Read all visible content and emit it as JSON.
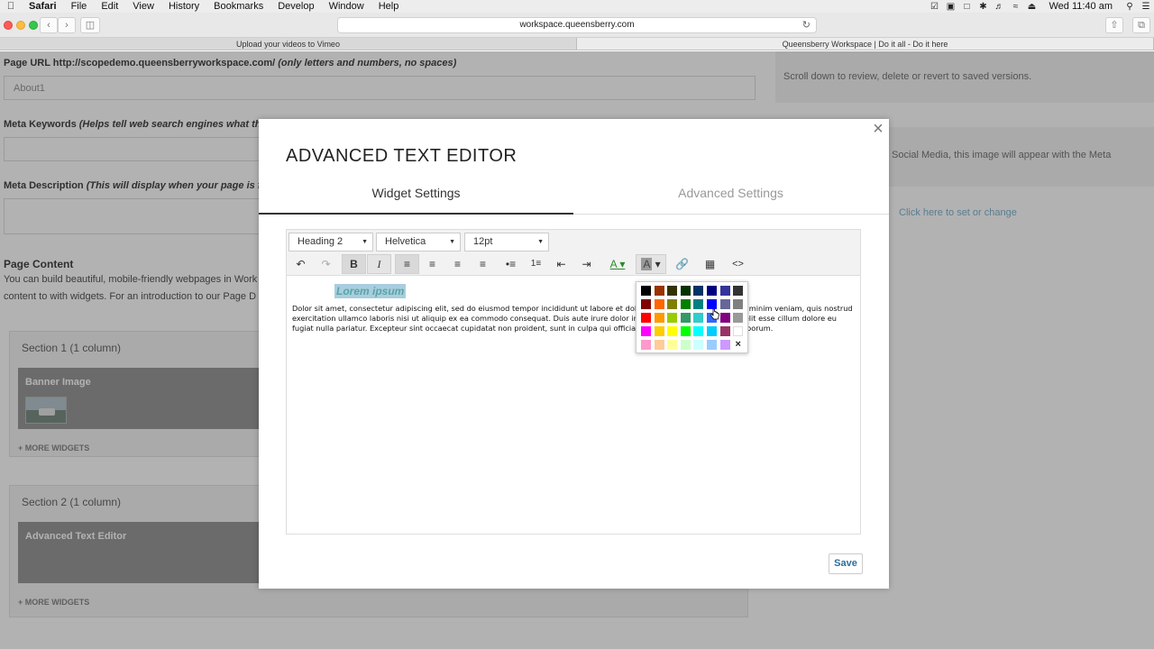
{
  "menubar": {
    "app": "Safari",
    "items": [
      "File",
      "Edit",
      "View",
      "History",
      "Bookmarks",
      "Develop",
      "Window",
      "Help"
    ],
    "clock": "Wed 11:40 am"
  },
  "browser": {
    "url": "workspace.queensberry.com",
    "tabs": [
      {
        "label": "Upload your videos to Vimeo"
      },
      {
        "label": "Queensberry Workspace | Do it all - Do it here"
      }
    ]
  },
  "page": {
    "page_url_label": "Page URL http://scopedemo.queensberryworkspace.com/",
    "page_url_hint": "(only letters and numbers, no spaces)",
    "page_url_value": "About1",
    "meta_keywords_label": "Meta Keywords",
    "meta_keywords_hint": "(Helps tell web search engines what this pa",
    "meta_description_label": "Meta Description",
    "meta_description_hint": "(This will display when your page is found",
    "page_content_heading": "Page Content",
    "page_content_line1": "You can build beautiful, mobile-friendly webpages in Work",
    "page_content_line2": "content to with widgets. For an introduction to our Page D",
    "sections": [
      {
        "title": "Section 1 (1 column)",
        "widget": "Banner Image",
        "more": "+ MORE WIDGETS"
      },
      {
        "title": "Section 2 (1 column)",
        "widget": "Advanced Text Editor",
        "more": "+ MORE WIDGETS"
      }
    ],
    "right_text1": "Scroll down to review, delete or revert to saved versions.",
    "right_text2": "Social Media, this image will appear with the Meta",
    "right_link": "Click here to set or change"
  },
  "modal": {
    "title": "ADVANCED TEXT EDITOR",
    "close_label": "×",
    "tabs": [
      "Widget Settings",
      "Advanced Settings"
    ],
    "active_tab": "Widget Settings",
    "save_label": "Save",
    "editor": {
      "block_format": "Heading 2",
      "font": "Helvetica",
      "size": "12pt",
      "heading_text": "Lorem ipsum",
      "paragraph_text": "Dolor sit amet, consectetur adipiscing elit, sed do eiusmod tempor incididunt ut labore et dolore magna aliqua. Ut enim ad minim veniam, quis nostrud exercitation ullamco laboris nisi ut aliquip ex ea commodo consequat. Duis aute irure dolor in reprehenderit in voluptate velit esse cillum dolore eu fugiat nulla pariatur. Excepteur sint occaecat cupidatat non proident, sunt in culpa qui officia deserunt mollit anim id est laborum.",
      "heading_color": "#58a6a0",
      "highlight_color": "#a9cde0"
    },
    "color_picker": {
      "swatches": [
        "#000000",
        "#993300",
        "#333300",
        "#003300",
        "#003366",
        "#000080",
        "#333399",
        "#333333",
        "#800000",
        "#ff6600",
        "#808000",
        "#008000",
        "#008080",
        "#0000ff",
        "#666699",
        "#808080",
        "#ff0000",
        "#ff9900",
        "#99cc00",
        "#339966",
        "#33cccc",
        "#3366ff",
        "#800080",
        "#999999",
        "#ff00ff",
        "#ffcc00",
        "#ffff00",
        "#00ff00",
        "#00ffff",
        "#00ccff",
        "#993366",
        "#ffffff",
        "#ff99cc",
        "#ffcc99",
        "#ffff99",
        "#ccffcc",
        "#ccffff",
        "#99ccff",
        "#cc99ff"
      ],
      "clear_label": "×"
    }
  }
}
